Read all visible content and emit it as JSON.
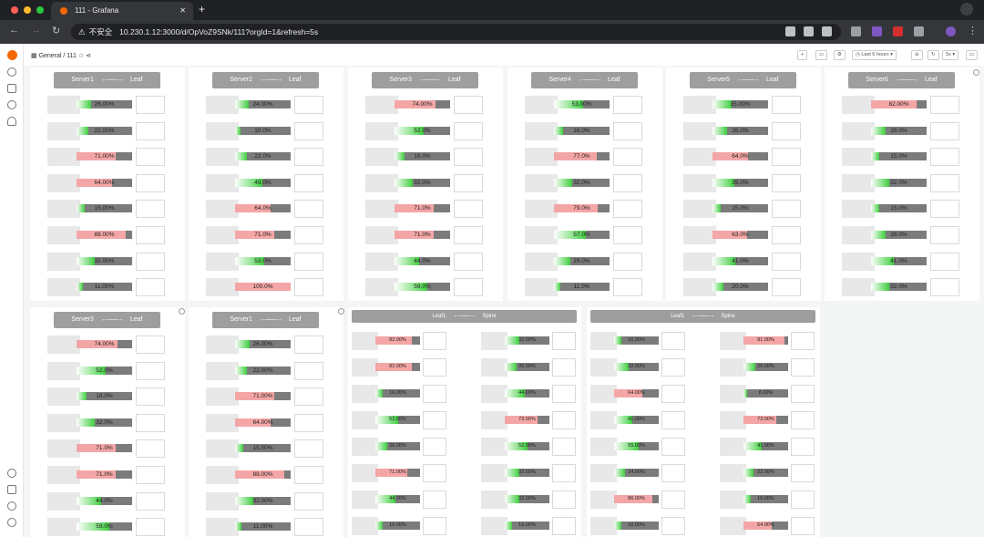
{
  "browser": {
    "tab_title": "111 - Grafana",
    "url": "10.230.1.12:3000/d/OpVoZ9SNk/111?orgId=1&refresh=5s",
    "insecure": "不安全"
  },
  "toolbar": {
    "breadcrumb": "General / 111",
    "time_range": "Last 6 hours",
    "refresh": "5s"
  },
  "panels": [
    {
      "title_left": "Server1",
      "title_right": "Leaf",
      "values": [
        "26.00%",
        "22.00%",
        "71.00%",
        "64.00%",
        "15.00%",
        "88.00%",
        "32.00%",
        "11.00%"
      ],
      "levels": [
        0.26,
        0.22,
        0.71,
        0.64,
        0.15,
        0.88,
        0.32,
        0.11
      ]
    },
    {
      "title_left": "Server2",
      "title_right": "Leaf",
      "values": [
        "24.00%",
        "10.0%",
        "22.0%",
        "49.0%",
        "64.0%",
        "71.0%",
        "53.0%",
        "100.0%"
      ],
      "levels": [
        0.24,
        0.1,
        0.22,
        0.49,
        0.64,
        0.71,
        0.53,
        1.0
      ]
    },
    {
      "title_left": "Server3",
      "title_right": "Leaf",
      "values": [
        "74.00%",
        "52.0%",
        "18.0%",
        "32.0%",
        "71.0%",
        "71.0%",
        "44.0%",
        "59.0%"
      ],
      "levels": [
        0.74,
        0.52,
        0.18,
        0.32,
        0.71,
        0.71,
        0.44,
        0.59
      ]
    },
    {
      "title_left": "Server4",
      "title_right": "Leaf",
      "values": [
        "53.00%",
        "16.0%",
        "77.0%",
        "32.0%",
        "79.0%",
        "57.0%",
        "29.0%",
        "11.0%"
      ],
      "levels": [
        0.53,
        0.16,
        0.77,
        0.32,
        0.79,
        0.57,
        0.29,
        0.11
      ]
    },
    {
      "title_left": "Server5",
      "title_right": "Leaf",
      "values": [
        "35.00%",
        "26.0%",
        "64.0%",
        "39.0%",
        "15.0%",
        "63.0%",
        "41.0%",
        "20.0%"
      ],
      "levels": [
        0.35,
        0.26,
        0.64,
        0.39,
        0.15,
        0.63,
        0.41,
        0.2
      ]
    },
    {
      "title_left": "Server6",
      "title_right": "Leaf",
      "values": [
        "82.00%",
        "26.0%",
        "15.0%",
        "32.0%",
        "15.0%",
        "26.0%",
        "41.0%",
        "32.0%"
      ],
      "levels": [
        0.82,
        0.26,
        0.15,
        0.32,
        0.15,
        0.26,
        0.41,
        0.32
      ]
    },
    {
      "title_left": "Server3",
      "title_right": "Leaf",
      "values": [
        "74.00%",
        "52.0%",
        "18.0%",
        "32.0%",
        "71.0%",
        "71.0%",
        "44.0%",
        "59.0%"
      ],
      "levels": [
        0.74,
        0.52,
        0.18,
        0.32,
        0.71,
        0.71,
        0.44,
        0.59
      ]
    },
    {
      "title_left": "Server1",
      "title_right": "Leaf",
      "values": [
        "26.00%",
        "22.00%",
        "71.00%",
        "64.00%",
        "15.00%",
        "88.00%",
        "32.00%",
        "11.00%"
      ],
      "levels": [
        0.26,
        0.22,
        0.71,
        0.64,
        0.15,
        0.88,
        0.32,
        0.11
      ]
    }
  ],
  "spine_panels": [
    {
      "title_left": "Leaf1",
      "title_right": "Spine",
      "left_values": [
        "82.00%",
        "82.00%",
        "16.00%",
        "52.00%",
        "26.00%",
        "71.00%",
        "44.00%",
        "16.00%"
      ],
      "left_levels": [
        0.82,
        0.82,
        0.16,
        0.52,
        0.26,
        0.71,
        0.44,
        0.16
      ],
      "right_values": [
        "32.00%",
        "26.00%",
        "44.00%",
        "73.00%",
        "52.00%",
        "32.00%",
        "32.00%",
        "16.00%"
      ],
      "right_levels": [
        0.32,
        0.26,
        0.44,
        0.73,
        0.52,
        0.32,
        0.32,
        0.16
      ]
    },
    {
      "title_left": "Leaf1",
      "title_right": "Spine",
      "left_values": [
        "16.00%",
        "32.00%",
        "64.00%",
        "41.00%",
        "55.00%",
        "24.00%",
        "86.00%",
        "16.00%"
      ],
      "left_levels": [
        0.16,
        0.32,
        0.64,
        0.41,
        0.55,
        0.24,
        0.86,
        0.16
      ],
      "right_values": [
        "91.00%",
        "26.00%",
        "8.00%",
        "73.00%",
        "41.00%",
        "22.00%",
        "16.00%",
        "64.00%"
      ],
      "right_levels": [
        0.91,
        0.26,
        0.08,
        0.73,
        0.41,
        0.22,
        0.16,
        0.64
      ]
    }
  ],
  "colors": {
    "high": "#f4a6a6",
    "low": "#3fcf3f",
    "bar_bg": "#7b7b7b",
    "header": "#9e9e9e"
  }
}
